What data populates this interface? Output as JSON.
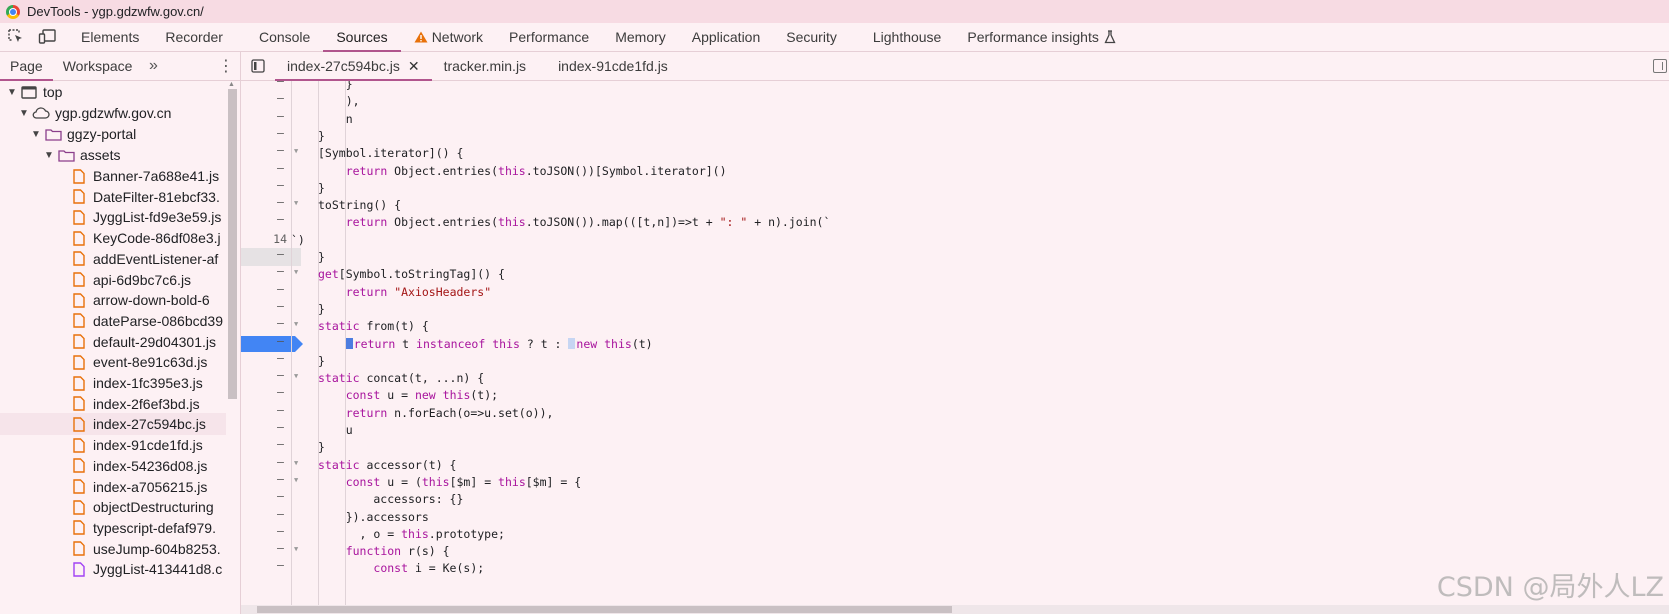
{
  "window": {
    "title": "DevTools - ygp.gdzwfw.gov.cn/"
  },
  "main_tabs": [
    {
      "label": "Elements"
    },
    {
      "label": "Recorder"
    },
    {
      "label": "Console"
    },
    {
      "label": "Sources",
      "active": true
    },
    {
      "label": "Network",
      "warning": true
    },
    {
      "label": "Performance"
    },
    {
      "label": "Memory"
    },
    {
      "label": "Application"
    },
    {
      "label": "Security"
    },
    {
      "label": "Lighthouse"
    },
    {
      "label": "Performance insights"
    }
  ],
  "nav_tabs": {
    "page": "Page",
    "workspace": "Workspace",
    "more": "»"
  },
  "file_tabs": [
    {
      "label": "index-27c594bc.js",
      "active": true
    },
    {
      "label": "tracker.min.js"
    },
    {
      "label": "index-91cde1fd.js"
    }
  ],
  "tree": {
    "top": "top",
    "domain": "ygp.gdzwfw.gov.cn",
    "folder": "ggzy-portal",
    "subfolder": "assets",
    "files": [
      "Banner-7a688e41.js",
      "DateFilter-81ebcf33.",
      "JyggList-fd9e3e59.js",
      "KeyCode-86df08e3.j",
      "addEventListener-af",
      "api-6d9bc7c6.js",
      "arrow-down-bold-6",
      "dateParse-086bcd39",
      "default-29d04301.js",
      "event-8e91c63d.js",
      "index-1fc395e3.js",
      "index-2f6ef3bd.js",
      "index-27c594bc.js",
      "index-91cde1fd.js",
      "index-54236d08.js",
      "index-a7056215.js",
      "objectDestructuring",
      "typescript-defaf979.",
      "useJump-604b8253.",
      "JyggList-413441d8.c"
    ],
    "selected_index": 12
  },
  "code": {
    "line_number_label": "14",
    "lines": [
      "    }",
      "    ),",
      "    n",
      "}",
      "[Symbol.iterator]() {",
      "    return Object.entries(this.toJSON())[Symbol.iterator]()",
      "}",
      "toString() {",
      "    return Object.entries(this.toJSON()).map(([t,n])=>t + \": \" + n).join(`",
      "`)",
      "}",
      "get[Symbol.toStringTag]() {",
      "    return \"AxiosHeaders\"",
      "}",
      "static from(t) {",
      "    return t instanceof this ? t : new this(t)",
      "}",
      "static concat(t, ...n) {",
      "    const u = new this(t);",
      "    return n.forEach(o=>u.set(o)),",
      "    u",
      "}",
      "static accessor(t) {",
      "    const u = (this[$m] = this[$m] = {",
      "        accessors: {}",
      "    }).accessors",
      "      , o = this.prototype;",
      "    function r(s) {",
      "        const i = Ke(s);"
    ]
  },
  "watermark": "CSDN @局外人LZ",
  "colors": {
    "accent": "#b1558d",
    "breakpoint": "#4285f4",
    "keyword": "#a8149d",
    "string": "#a31515"
  }
}
